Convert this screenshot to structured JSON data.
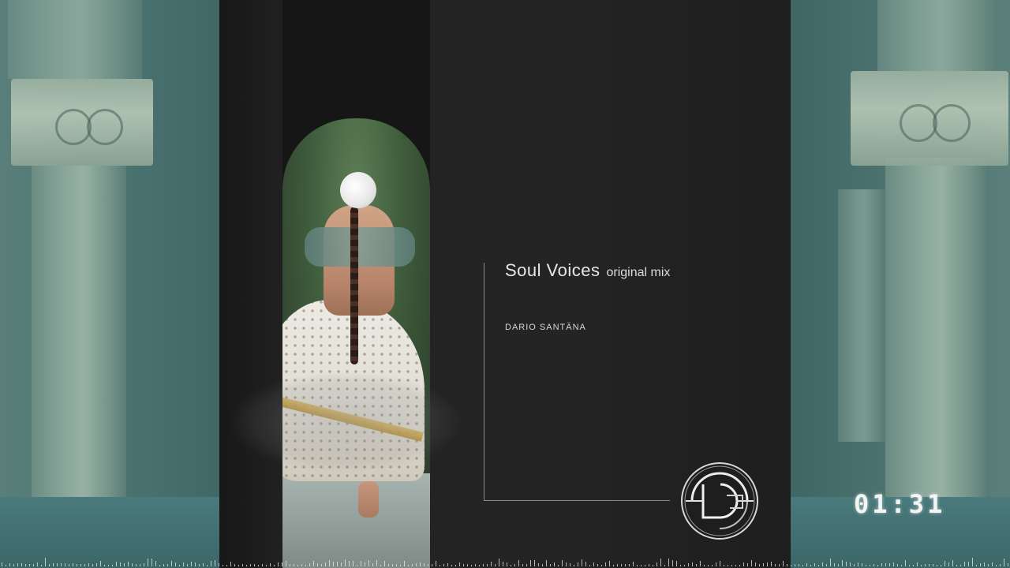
{
  "track": {
    "title": "Soul Voices",
    "mix": "original mix",
    "artist": "DARIO SANTÄNA"
  },
  "player": {
    "elapsed": "01:31"
  },
  "logo": {
    "icon": "ds-monogram-icon"
  },
  "colors": {
    "background_tint": "#3f6a6a",
    "panel": "#222222",
    "text": "#e8e8e8",
    "rule": "#8a8a8a"
  }
}
